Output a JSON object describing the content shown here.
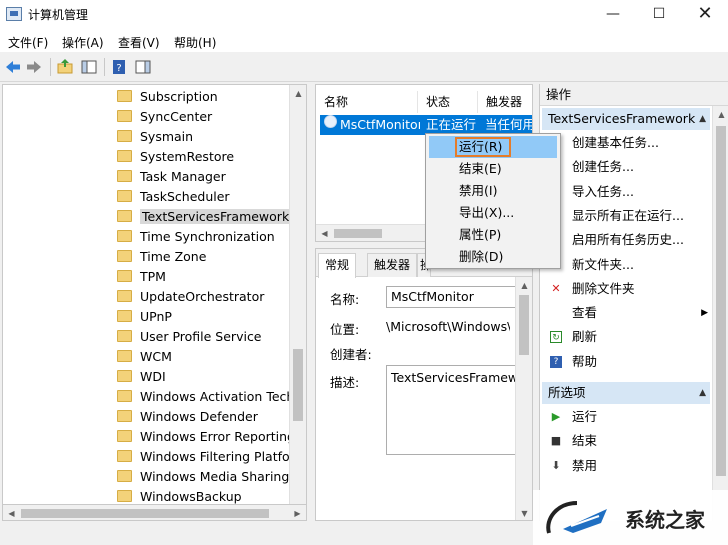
{
  "window": {
    "title": "计算机管理",
    "minimize_glyph": "—",
    "maximize_glyph": "☐",
    "close_glyph": "✕"
  },
  "menu": [
    "文件(F)",
    "操作(A)",
    "查看(V)",
    "帮助(H)"
  ],
  "tree": {
    "items": [
      "Subscription",
      "SyncCenter",
      "Sysmain",
      "SystemRestore",
      "Task Manager",
      "TaskScheduler",
      "TextServicesFramework",
      "Time Synchronization",
      "Time Zone",
      "TPM",
      "UpdateOrchestrator",
      "UPnP",
      "User Profile Service",
      "WCM",
      "WDI",
      "Windows Activation Technologies",
      "Windows Defender",
      "Windows Error Reporting",
      "Windows Filtering Platform",
      "Windows Media Sharing",
      "WindowsBackup"
    ],
    "selected": "TextServicesFramework"
  },
  "task_list": {
    "columns": [
      "名称",
      "状态",
      "触发器"
    ],
    "rows": [
      {
        "name": "MsCtfMonitor",
        "status": "正在运行",
        "trigger": "当任何用户登录时"
      }
    ]
  },
  "context_menu": {
    "items": [
      "运行(R)",
      "结束(E)",
      "禁用(I)",
      "导出(X)...",
      "属性(P)",
      "删除(D)"
    ],
    "highlighted": "运行(R)"
  },
  "properties": {
    "tabs": [
      "常规",
      "触发器",
      "操作"
    ],
    "active_tab": "常规",
    "name_label": "名称:",
    "name_value": "MsCtfMonitor",
    "location_label": "位置:",
    "location_value": "\\Microsoft\\Windows\\TextServicesFramework",
    "author_label": "创建者:",
    "desc_label": "描述:",
    "desc_value": "TextServicesFramework monitor task"
  },
  "actions": {
    "header": "操作",
    "section1": "TextServicesFramework",
    "items1": [
      {
        "label": "创建基本任务...",
        "icon": "task-wizard-icon"
      },
      {
        "label": "创建任务...",
        "icon": "task-icon"
      },
      {
        "label": "导入任务...",
        "icon": "import-icon"
      },
      {
        "label": "显示所有正在运行...",
        "icon": "running-tasks-icon"
      },
      {
        "label": "启用所有任务历史...",
        "icon": "history-icon"
      },
      {
        "label": "新文件夹...",
        "icon": "new-folder-icon"
      },
      {
        "label": "删除文件夹",
        "icon": "delete-icon"
      },
      {
        "label": "查看",
        "icon": "view-icon"
      },
      {
        "label": "刷新",
        "icon": "refresh-icon"
      },
      {
        "label": "帮助",
        "icon": "help-icon"
      }
    ],
    "section2": "所选项",
    "items2": [
      {
        "label": "运行",
        "icon": "run-icon"
      },
      {
        "label": "结束",
        "icon": "stop-icon"
      },
      {
        "label": "禁用",
        "icon": "disable-icon"
      }
    ]
  },
  "watermark": {
    "text": "系统之家"
  },
  "colors": {
    "selection": "#0078d7",
    "menu_highlight": "#91c9f7",
    "focus_box": "#e57c2a",
    "section_bg": "#d6e6f5"
  }
}
